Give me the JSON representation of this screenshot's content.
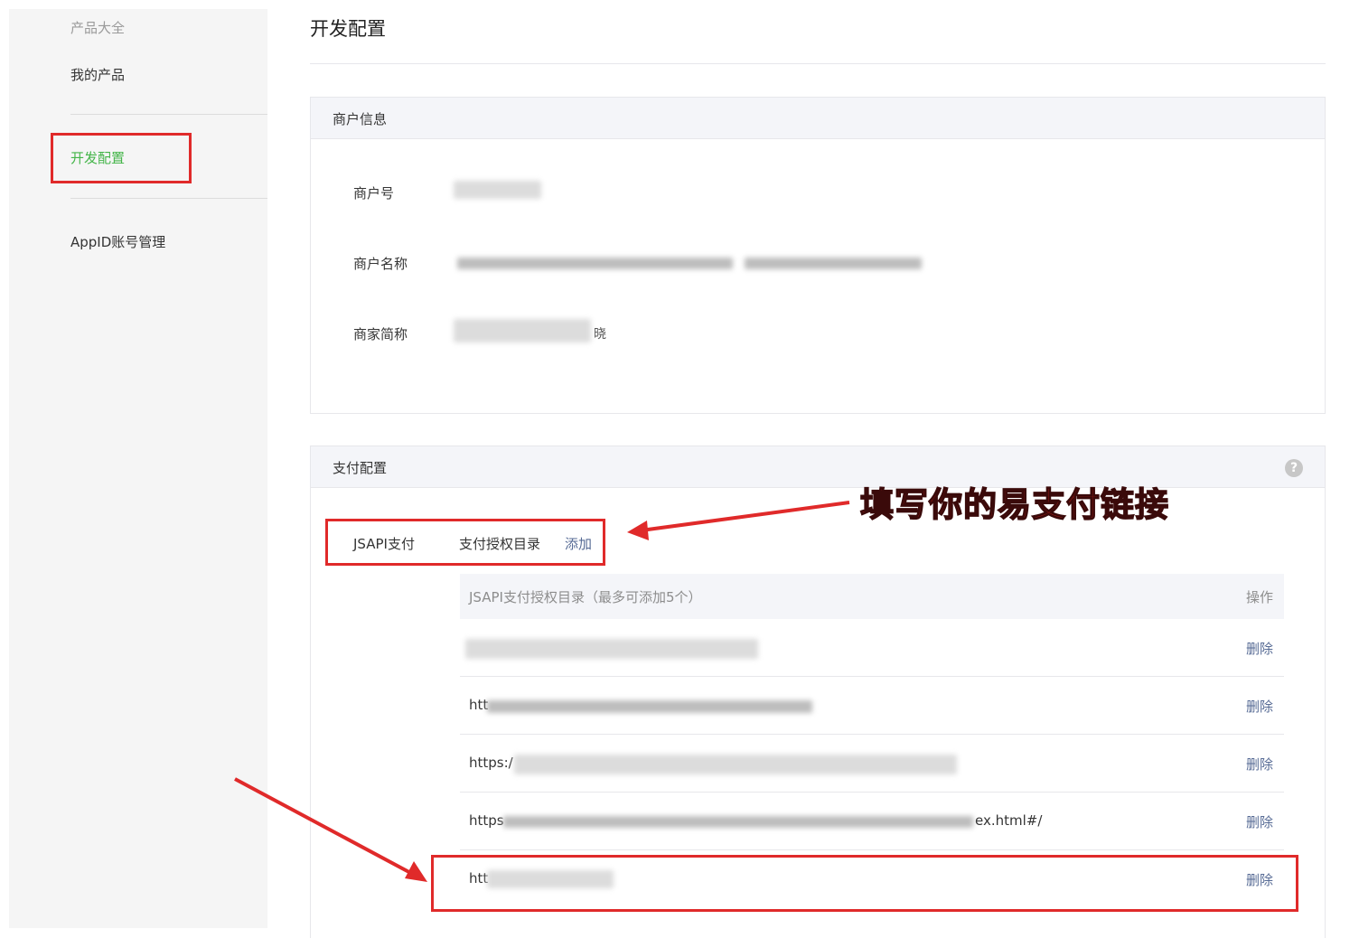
{
  "sidebar": {
    "group_title": "产品大全",
    "items": [
      {
        "label": "我的产品"
      },
      {
        "label": "开发配置"
      },
      {
        "label": "AppID账号管理"
      }
    ]
  },
  "page": {
    "title": "开发配置"
  },
  "merchant_panel": {
    "title": "商户信息",
    "fields": [
      {
        "label": "商户号"
      },
      {
        "label": "商户名称"
      },
      {
        "label": "商家简称",
        "visible_tail": "晓"
      }
    ]
  },
  "pay_panel": {
    "title": "支付配置",
    "help_icon": "?",
    "jsapi_label": "JSAPI支付",
    "dir_label": "支付授权目录",
    "add_label": "添加",
    "table": {
      "header": "JSAPI支付授权目录（最多可添加5个）",
      "action_header": "操作",
      "rows": [
        {
          "url_prefix": "",
          "url_suffix": "",
          "action": "删除"
        },
        {
          "url_prefix": "htt",
          "url_suffix": "",
          "action": "删除"
        },
        {
          "url_prefix": "https:/",
          "url_suffix": "",
          "action": "删除"
        },
        {
          "url_prefix": "https",
          "url_suffix": "ex.html#/",
          "action": "删除"
        },
        {
          "url_prefix": "htt",
          "url_suffix": "",
          "action": "删除"
        }
      ]
    }
  },
  "annotation": {
    "text": "填写你的易支付链接",
    "color": "#e8231c"
  },
  "colors": {
    "active_green": "#44b549",
    "link_blue": "#576b95",
    "highlight_red": "#e02a2a"
  }
}
